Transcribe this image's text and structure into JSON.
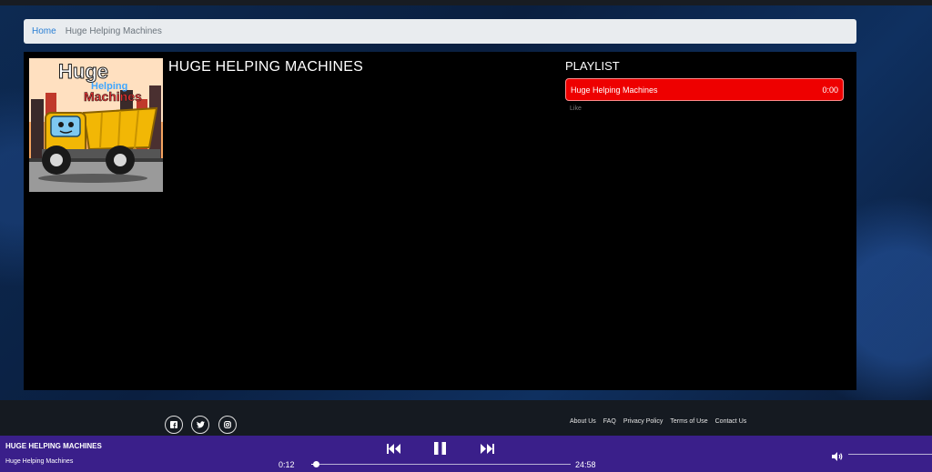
{
  "breadcrumb": {
    "home": "Home",
    "current": "Huge Helping Machines"
  },
  "album": {
    "title": "HUGE HELPING MACHINES",
    "cover_text": {
      "line1": "Huge",
      "line2": "Helping",
      "line3": "Machines"
    }
  },
  "playlist": {
    "heading": "PLAYLIST",
    "tracks": [
      {
        "name": "Huge Helping Machines",
        "duration": "0:00"
      }
    ],
    "like_label": "Like"
  },
  "footer": {
    "social": [
      "facebook-icon",
      "twitter-icon",
      "instagram-icon"
    ],
    "links": [
      "About Us",
      "FAQ",
      "Privacy Policy",
      "Terms of Use",
      "Contact Us"
    ]
  },
  "player": {
    "album_title": "HUGE HELPING MACHINES",
    "track_title": "Huge Helping Machines",
    "elapsed": "0:12",
    "total": "24:58",
    "progress": 0.008,
    "volume": 1
  },
  "colors": {
    "accent_red": "#ee0000",
    "player_bg": "#3a1f8a",
    "link_blue": "#2a7fd4"
  }
}
